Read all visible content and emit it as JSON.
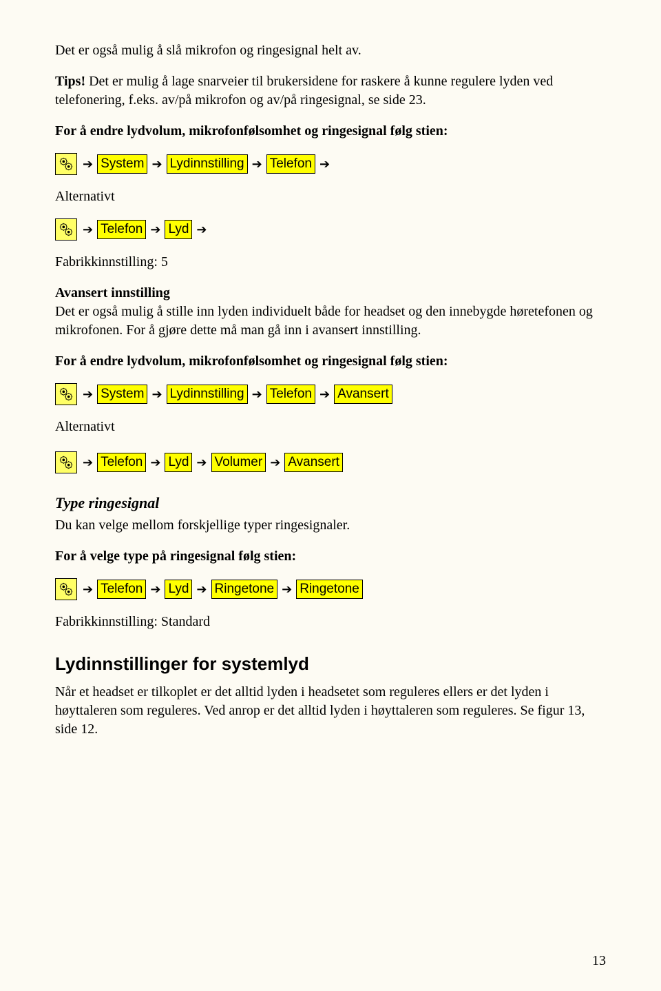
{
  "para1": "Det er også mulig å slå mikrofon og ringesignal helt av.",
  "tips_label": "Tips!",
  "tips_text": " Det er mulig å lage snarveier til brukersidene for raskere å kunne regulere lyden ved telefonering, f.eks. av/på mikrofon og av/på ringesignal, se side 23.",
  "heading1": "For å endre lydvolum, mikrofonfølsomhet og ringesignal følg stien:",
  "path1": {
    "a": "System",
    "b": "Lydinnstilling",
    "c": "Telefon"
  },
  "alt_label": "Alternativt",
  "path2": {
    "a": "Telefon",
    "b": "Lyd"
  },
  "fabrikk1": "Fabrikkinnstilling: 5",
  "advanced_h": "Avansert innstilling",
  "advanced_p": "Det er også mulig å stille inn lyden individuelt både for headset og den innebygde høretefonen og mikrofonen. For å gjøre dette må man gå inn i avansert innstilling.",
  "heading2": "For å endre lydvolum, mikrofonfølsomhet og ringesignal følg stien:",
  "path3": {
    "a": "System",
    "b": "Lydinnstilling",
    "c": "Telefon",
    "d": "Avansert"
  },
  "path4": {
    "a": "Telefon",
    "b": "Lyd",
    "c": "Volumer",
    "d": "Avansert"
  },
  "type_h": "Type ringesignal",
  "type_p": "Du kan velge mellom forskjellige typer ringesignaler.",
  "heading3": "For å velge type på ringesignal følg stien:",
  "path5": {
    "a": "Telefon",
    "b": "Lyd",
    "c": "Ringetone",
    "d": "Ringetone"
  },
  "fabrikk2": "Fabrikkinnstilling: Standard",
  "sys_h": "Lydinnstillinger for systemlyd",
  "sys_p": "Når et headset er tilkoplet er det alltid lyden i headsetet som reguleres ellers er det lyden i høyttaleren som reguleres. Ved anrop er det alltid lyden i høyttaleren som reguleres. Se figur 13, side 12.",
  "page": "13"
}
